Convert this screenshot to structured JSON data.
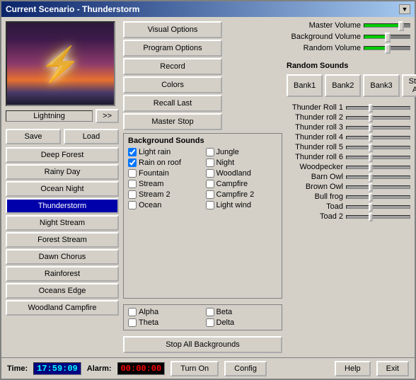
{
  "window": {
    "title": "Current Scenario - Thunderstorm"
  },
  "preview": {
    "label": "Lightning",
    "nav_label": ">>"
  },
  "toolbar": {
    "visual_options": "Visual Options",
    "program_options": "Program Options",
    "record": "Record",
    "colors": "Colors",
    "recall_last": "Recall Last",
    "master_stop": "Master Stop"
  },
  "save_load": {
    "save": "Save",
    "load": "Load"
  },
  "scenarios": [
    {
      "label": "Deep Forest",
      "active": false
    },
    {
      "label": "Rainy Day",
      "active": false
    },
    {
      "label": "Ocean Night",
      "active": false
    },
    {
      "label": "Thunderstorm",
      "active": true
    },
    {
      "label": "Night Stream",
      "active": false
    },
    {
      "label": "Forest Stream",
      "active": false
    },
    {
      "label": "Dawn Chorus",
      "active": false
    },
    {
      "label": "Rainforest",
      "active": false
    },
    {
      "label": "Oceans Edge",
      "active": false
    },
    {
      "label": "Woodland Campfire",
      "active": false
    }
  ],
  "background_sounds": {
    "title": "Background Sounds",
    "sounds": [
      {
        "label": "Light rain",
        "checked": true
      },
      {
        "label": "Jungle",
        "checked": false
      },
      {
        "label": "Rain on roof",
        "checked": true
      },
      {
        "label": "Night",
        "checked": false
      },
      {
        "label": "Fountain",
        "checked": false
      },
      {
        "label": "Woodland",
        "checked": false
      },
      {
        "label": "Stream",
        "checked": false
      },
      {
        "label": "Campfire",
        "checked": false
      },
      {
        "label": "Stream 2",
        "checked": false
      },
      {
        "label": "Campfire 2",
        "checked": false
      },
      {
        "label": "Ocean",
        "checked": false
      },
      {
        "label": "Light wind",
        "checked": false
      }
    ],
    "waves": [
      {
        "label": "Alpha",
        "checked": false
      },
      {
        "label": "Beta",
        "checked": false
      },
      {
        "label": "Theta",
        "checked": false
      },
      {
        "label": "Delta",
        "checked": false
      }
    ],
    "stop_all_label": "Stop All Backgrounds"
  },
  "volume": {
    "master_label": "Master Volume",
    "background_label": "Background Volume",
    "random_label": "Random Volume",
    "master_pct": 80,
    "background_pct": 50,
    "random_pct": 50
  },
  "random_sounds": {
    "title": "Random Sounds",
    "bank1": "Bank1",
    "bank2": "Bank2",
    "bank3": "Bank3",
    "stop_all": "Stop All",
    "sounds": [
      {
        "label": "Thunder Roll 1",
        "pct": 35
      },
      {
        "label": "Thunder roll 2",
        "pct": 35
      },
      {
        "label": "Thunder roll 3",
        "pct": 35
      },
      {
        "label": "Thunder roll 4",
        "pct": 35
      },
      {
        "label": "Thunder roll 5",
        "pct": 35
      },
      {
        "label": "Thunder roll 6",
        "pct": 35
      },
      {
        "label": "Woodpecker",
        "pct": 35
      },
      {
        "label": "Barn Owl",
        "pct": 35
      },
      {
        "label": "Brown Owl",
        "pct": 35
      },
      {
        "label": "Bull frog",
        "pct": 35
      },
      {
        "label": "Toad",
        "pct": 35
      },
      {
        "label": "Toad 2",
        "pct": 35
      }
    ]
  },
  "bottom_bar": {
    "time_label": "Time:",
    "time_value": "17:59:09",
    "alarm_label": "Alarm:",
    "alarm_value": "00:00:00",
    "turn_on": "Turn On",
    "config": "Config",
    "help": "Help",
    "exit": "Exit"
  }
}
